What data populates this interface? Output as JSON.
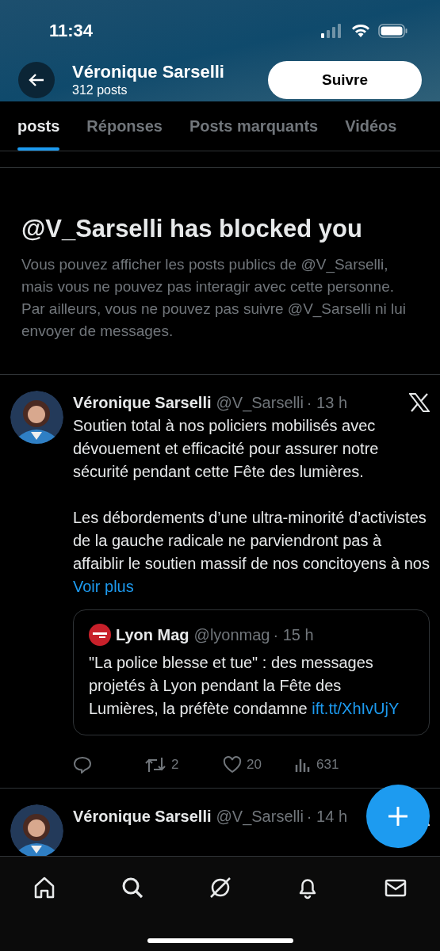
{
  "status_bar": {
    "time": "11:34"
  },
  "header": {
    "name": "Véronique Sarselli",
    "post_count": "312 posts",
    "follow_button": "Suivre"
  },
  "tabs": [
    {
      "label": "posts",
      "selected": true
    },
    {
      "label": "Réponses",
      "selected": false
    },
    {
      "label": "Posts marquants",
      "selected": false
    },
    {
      "label": "Vidéos",
      "selected": false
    }
  ],
  "blocked_notice": {
    "title": "@V_Sarselli has blocked you",
    "body": "Vous pouvez afficher les posts publics de @V_Sarselli, mais vous ne pouvez pas interagir avec cette personne. Par ailleurs, vous ne pouvez pas suivre @V_Sarselli ni lui envoyer de messages."
  },
  "posts": [
    {
      "author": "Véronique Sarselli",
      "handle": "@V_Sarselli",
      "time": "· 13 h",
      "paragraphs": [
        "Soutien total à nos policiers mobilisés avec dévouement et efficacité pour assurer notre sécurité pendant cette Fête des lumières.",
        "Les débordements d’une ultra-minorité d’activistes de la gauche radicale ne parviendront pas à affaiblir le soutien massif de nos concitoyens à nos"
      ],
      "more_link": "Voir plus",
      "quote": {
        "author": "Lyon Mag",
        "handle": "@lyonmag",
        "time": "· 15 h",
        "text": "\"La police blesse et tue\" : des messages projetés à Lyon pendant la Fête des Lumières, la préfète condamne",
        "link": "ift.tt/XhIvUjY"
      },
      "actions": [
        {
          "kind": "reply"
        },
        {
          "kind": "repost",
          "count": "2"
        },
        {
          "kind": "like",
          "count": "20"
        },
        {
          "kind": "views",
          "count": "631"
        }
      ]
    },
    {
      "author": "Véronique Sarselli",
      "handle": "@V_Sarselli",
      "time": "· 14 h"
    }
  ],
  "nav": [
    {
      "kind": "home"
    },
    {
      "kind": "search"
    },
    {
      "kind": "grok"
    },
    {
      "kind": "notifications"
    },
    {
      "kind": "messages"
    }
  ]
}
